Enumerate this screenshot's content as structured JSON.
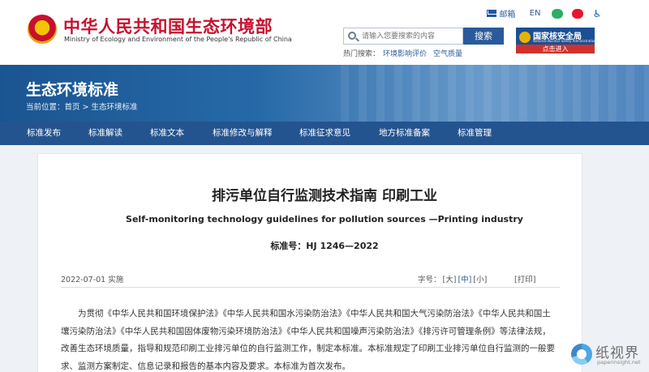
{
  "header": {
    "ministry_cn": "中华人民共和国生态环境部",
    "ministry_en": "Ministry of Ecology and Environment of the People's Republic of China",
    "toplinks": {
      "mail": "邮箱",
      "lang": "EN"
    },
    "search": {
      "placeholder": "请输入您要搜索的内容",
      "button": "搜索"
    },
    "hot": {
      "label": "热门搜索：",
      "items": [
        "环境影响评价",
        "空气质量"
      ]
    },
    "nsa": {
      "cn": "国家核安全局",
      "en": "National Nuclear Safety Administration",
      "enter": "点击进入"
    }
  },
  "banner": {
    "title": "生态环境标准",
    "breadcrumb": "当前位置：首页 > 生态环境标准"
  },
  "nav": {
    "items": [
      "标准发布",
      "标准解读",
      "标准文本",
      "标准修改与解释",
      "标准征求意见",
      "地方标准备案",
      "标准管理"
    ]
  },
  "doc": {
    "title_cn": "排污单位自行监测技术指南 印刷工业",
    "title_en": "Self-monitoring technology guidelines for pollution sources —Printing industry",
    "standard_no": "标准号：HJ 1246—2022",
    "date": "2022-07-01 实施",
    "font_size": {
      "label": "字号：",
      "large": "[大]",
      "medium": "[中]",
      "small": "[小]",
      "selected": "medium"
    },
    "print": "[打印]",
    "body": "为贯彻《中华人民共和国环境保护法》《中华人民共和国水污染防治法》《中华人民共和国大气污染防治法》《中华人民共和国土壤污染防治法》《中华人民共和国固体废物污染环境防治法》《中华人民共和国噪声污染防治法》《排污许可管理条例》等法律法规，改善生态环境质量，指导和规范印刷工业排污单位的自行监测工作，制定本标准。本标准规定了印刷工业排污单位自行监测的一般要求、监测方案制定、信息记录和报告的基本内容及要求。本标准为首次发布。"
  },
  "watermark": {
    "cn": "纸视界",
    "url": "paperinsight.net"
  },
  "colors": {
    "brand_red": "#c8102e",
    "nav_blue": "#24548f",
    "link_blue": "#2d5b9a"
  }
}
